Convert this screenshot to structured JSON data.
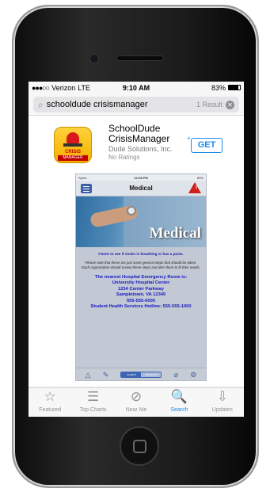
{
  "status_bar": {
    "carrier": "Verizon",
    "network": "LTE",
    "time": "9:10 AM",
    "battery": "83%",
    "battery_level": 0.83
  },
  "search": {
    "query": "schooldude crisismanager",
    "result_count": "1 Result"
  },
  "app": {
    "name": "SchoolDude CrisisManager",
    "developer": "Dude Solutions, Inc.",
    "ratings": "No Ratings",
    "get_label": "GET",
    "icon_text_top": "CRISIS",
    "icon_text_bottom": "MANAGER"
  },
  "screenshot": {
    "status_left": "Sprint",
    "status_time": "12:08 PM",
    "status_right": "85%",
    "nav_title": "Medical",
    "hero_word": "Medical",
    "check_line": "Check to see if victim is breathing or has a pulse.",
    "note": "Please note that these are just some general steps that should be taken. Each organization should review these steps and alter them to fit their needs.",
    "hospital_lines": [
      "The nearest Hospital Emergency Room is:",
      "University Hospital Center",
      "1234 Center Parkway",
      "Sampletown, VA 12345",
      "555-555-0000",
      "Student Health Services Hotline: 555-555-1000"
    ],
    "seg_labels": [
      "ALERTS",
      "CONTACTS"
    ]
  },
  "tabs": [
    {
      "label": "Featured",
      "icon": "star-icon",
      "glyph": "☆",
      "active": false
    },
    {
      "label": "Top Charts",
      "icon": "list-icon",
      "glyph": "☰",
      "active": false
    },
    {
      "label": "Near Me",
      "icon": "compass-icon",
      "glyph": "⊘",
      "active": false
    },
    {
      "label": "Search",
      "icon": "search-icon",
      "glyph": "🔍",
      "active": true
    },
    {
      "label": "Updates",
      "icon": "download-tray-icon",
      "glyph": "⇩",
      "active": false
    }
  ],
  "colors": {
    "accent": "#1a8bea",
    "hospital_text": "#1717c0",
    "alert_red": "#d21b1b"
  }
}
